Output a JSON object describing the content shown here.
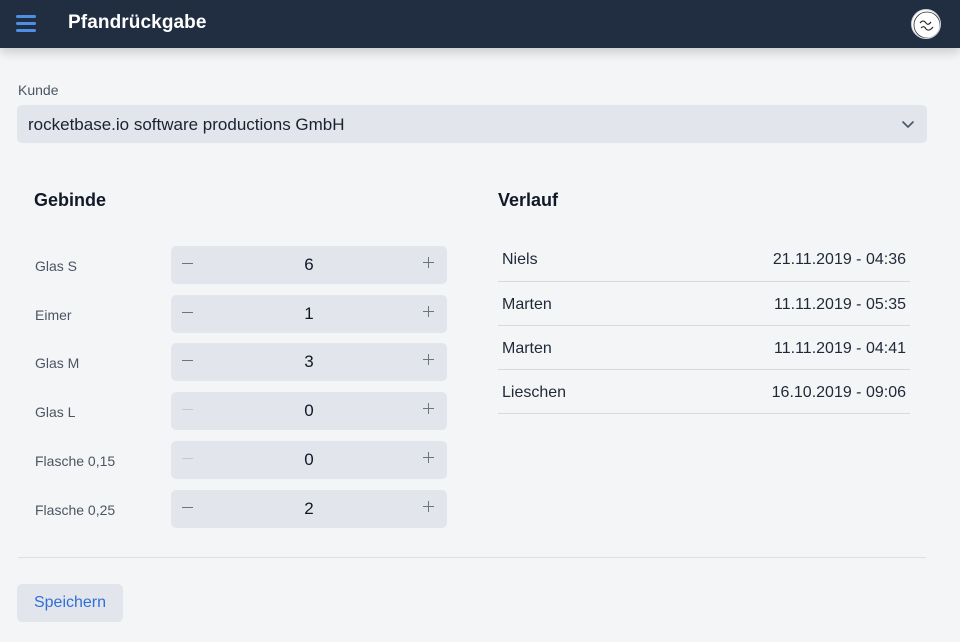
{
  "header": {
    "title": "Pfandrückgabe",
    "menu_icon": "menu-icon",
    "logo_icon": "brand-logo-icon"
  },
  "customer": {
    "label": "Kunde",
    "selected": "rocketbase.io software productions GmbH"
  },
  "gebinde": {
    "title": "Gebinde",
    "items": [
      {
        "label": "Glas S",
        "value": "6",
        "minus_disabled": false
      },
      {
        "label": "Eimer",
        "value": "1",
        "minus_disabled": false
      },
      {
        "label": "Glas M",
        "value": "3",
        "minus_disabled": false
      },
      {
        "label": "Glas L",
        "value": "0",
        "minus_disabled": true
      },
      {
        "label": "Flasche 0,15",
        "value": "0",
        "minus_disabled": true
      },
      {
        "label": "Flasche 0,25",
        "value": "2",
        "minus_disabled": false
      }
    ]
  },
  "verlauf": {
    "title": "Verlauf",
    "entries": [
      {
        "name": "Niels",
        "date": "21.11.2019 - 04:36"
      },
      {
        "name": "Marten",
        "date": "11.11.2019 - 05:35"
      },
      {
        "name": "Marten",
        "date": "11.11.2019 - 04:41"
      },
      {
        "name": "Lieschen",
        "date": "16.10.2019 - 09:06"
      }
    ]
  },
  "actions": {
    "save_label": "Speichern"
  },
  "colors": {
    "topbar": "#212e42",
    "accent": "#4e8fe6",
    "link": "#2f6fd6",
    "control_bg": "#e2e6ec",
    "page_bg": "#f4f5f7"
  }
}
